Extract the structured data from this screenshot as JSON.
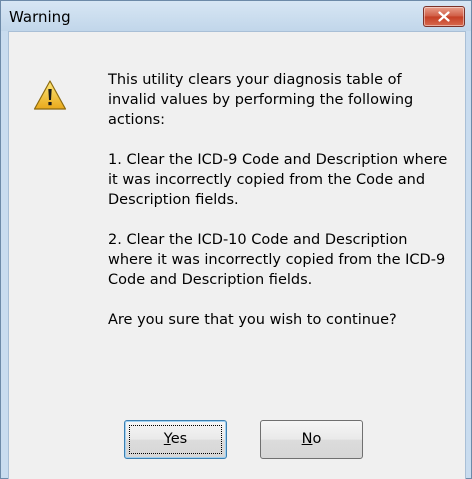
{
  "window": {
    "title": "Warning",
    "close_icon": "close-icon"
  },
  "icon": "warning-triangle-icon",
  "message": {
    "para1": "This utility clears your diagnosis table of invalid values by performing the following actions:",
    "para2": "1. Clear the ICD-9 Code and Description where it was incorrectly copied from the Code and Description fields.",
    "para3": "2. Clear the ICD-10 Code and Description where it was incorrectly copied from the ICD-9 Code and Description fields.",
    "question": "Are you sure that you wish to continue?"
  },
  "buttons": {
    "yes_first": "Y",
    "yes_rest": "es",
    "no_first": "N",
    "no_rest": "o"
  },
  "colors": {
    "title_bar": "#c9dcef",
    "close_button": "#c43e24",
    "warning_yellow": "#f3c12f"
  }
}
